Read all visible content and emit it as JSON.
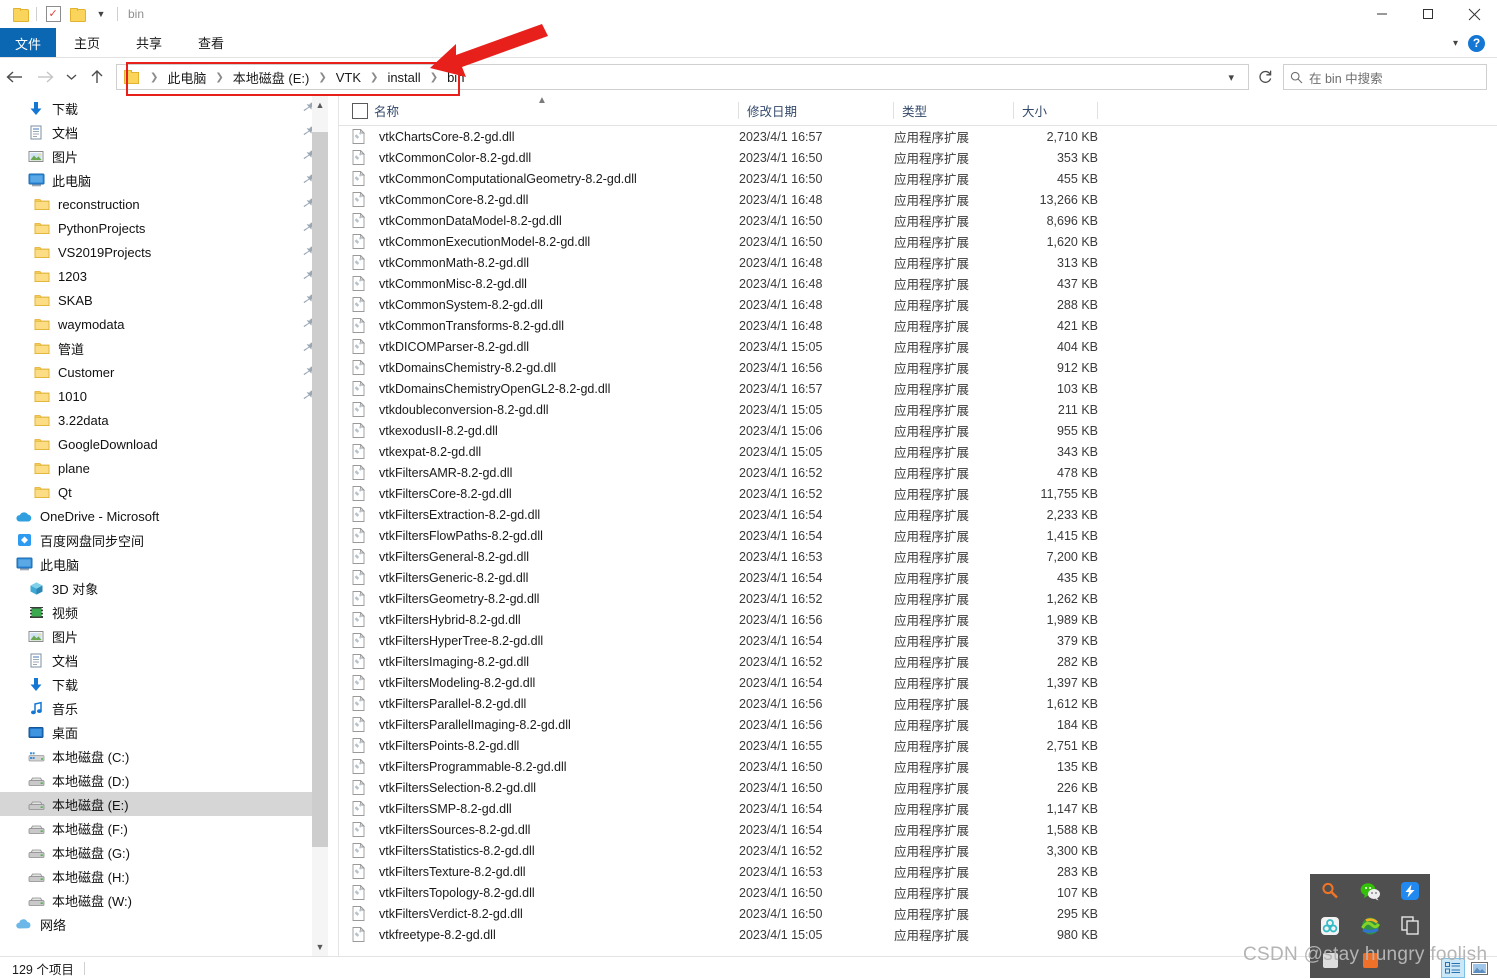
{
  "window": {
    "title": "bin",
    "quick_access": [
      "folder-icon",
      "properties-icon",
      "new-folder-icon",
      "customize-chevron-icon"
    ],
    "controls": {
      "minimize": "minimize-icon",
      "maximize": "maximize-icon",
      "close": "close-icon"
    }
  },
  "ribbon": {
    "tabs": [
      {
        "label": "文件",
        "active": true
      },
      {
        "label": "主页",
        "active": false
      },
      {
        "label": "共享",
        "active": false
      },
      {
        "label": "查看",
        "active": false
      }
    ],
    "collapse_label": "⌄",
    "help_label": "?"
  },
  "nav_toolbar": {
    "back": "back-arrow-icon",
    "forward": "forward-arrow-icon",
    "recent": "chevron-down-icon",
    "up": "up-arrow-icon",
    "refresh": "refresh-icon"
  },
  "breadcrumb": {
    "icon": "folder-icon",
    "items": [
      "此电脑",
      "本地磁盘 (E:)",
      "VTK",
      "install",
      "bin"
    ],
    "separator": "›",
    "dropdown": "chevron-down-icon",
    "highlighted": true
  },
  "search": {
    "icon": "search-icon",
    "placeholder": "在 bin 中搜索",
    "value": ""
  },
  "sidebar": {
    "items": [
      {
        "label": "下载",
        "icon": "download-icon",
        "indent": 1,
        "pinned": true,
        "selected": false
      },
      {
        "label": "文档",
        "icon": "documents-icon",
        "indent": 1,
        "pinned": true,
        "selected": false
      },
      {
        "label": "图片",
        "icon": "pictures-icon",
        "indent": 1,
        "pinned": true,
        "selected": false
      },
      {
        "label": "此电脑",
        "icon": "this-pc-icon",
        "indent": 1,
        "pinned": true,
        "selected": false
      },
      {
        "label": "reconstruction",
        "icon": "folder-icon",
        "indent": 2,
        "pinned": true,
        "selected": false
      },
      {
        "label": "PythonProjects",
        "icon": "folder-icon",
        "indent": 2,
        "pinned": true,
        "selected": false
      },
      {
        "label": "VS2019Projects",
        "icon": "folder-icon",
        "indent": 2,
        "pinned": true,
        "selected": false
      },
      {
        "label": "1203",
        "icon": "folder-icon",
        "indent": 2,
        "pinned": true,
        "selected": false
      },
      {
        "label": "SKAB",
        "icon": "folder-icon",
        "indent": 2,
        "pinned": true,
        "selected": false
      },
      {
        "label": "waymodata",
        "icon": "folder-icon",
        "indent": 2,
        "pinned": true,
        "selected": false
      },
      {
        "label": "管道",
        "icon": "folder-icon",
        "indent": 2,
        "pinned": true,
        "selected": false
      },
      {
        "label": "Customer",
        "icon": "folder-icon",
        "indent": 2,
        "pinned": true,
        "selected": false
      },
      {
        "label": "1010",
        "icon": "folder-icon",
        "indent": 2,
        "pinned": true,
        "selected": false
      },
      {
        "label": "3.22data",
        "icon": "folder-icon",
        "indent": 2,
        "pinned": false,
        "selected": false
      },
      {
        "label": "GoogleDownload",
        "icon": "folder-icon",
        "indent": 2,
        "pinned": false,
        "selected": false
      },
      {
        "label": "plane",
        "icon": "folder-icon",
        "indent": 2,
        "pinned": false,
        "selected": false
      },
      {
        "label": "Qt",
        "icon": "folder-icon",
        "indent": 2,
        "pinned": false,
        "selected": false
      },
      {
        "label": "OneDrive - Microsoft",
        "icon": "onedrive-icon",
        "indent": 0,
        "pinned": false,
        "selected": false
      },
      {
        "label": "百度网盘同步空间",
        "icon": "baidu-netdisk-icon",
        "indent": 0,
        "pinned": false,
        "selected": false
      },
      {
        "label": "此电脑",
        "icon": "this-pc-icon",
        "indent": 0,
        "pinned": false,
        "selected": false
      },
      {
        "label": "3D 对象",
        "icon": "3d-objects-icon",
        "indent": 1,
        "pinned": false,
        "selected": false
      },
      {
        "label": "视频",
        "icon": "videos-icon",
        "indent": 1,
        "pinned": false,
        "selected": false
      },
      {
        "label": "图片",
        "icon": "pictures-icon",
        "indent": 1,
        "pinned": false,
        "selected": false
      },
      {
        "label": "文档",
        "icon": "documents-icon",
        "indent": 1,
        "pinned": false,
        "selected": false
      },
      {
        "label": "下载",
        "icon": "download-icon",
        "indent": 1,
        "pinned": false,
        "selected": false
      },
      {
        "label": "音乐",
        "icon": "music-icon",
        "indent": 1,
        "pinned": false,
        "selected": false
      },
      {
        "label": "桌面",
        "icon": "desktop-icon",
        "indent": 1,
        "pinned": false,
        "selected": false
      },
      {
        "label": "本地磁盘 (C:)",
        "icon": "system-drive-icon",
        "indent": 1,
        "pinned": false,
        "selected": false
      },
      {
        "label": "本地磁盘 (D:)",
        "icon": "drive-icon",
        "indent": 1,
        "pinned": false,
        "selected": false
      },
      {
        "label": "本地磁盘 (E:)",
        "icon": "drive-icon",
        "indent": 1,
        "pinned": false,
        "selected": true
      },
      {
        "label": "本地磁盘 (F:)",
        "icon": "drive-icon",
        "indent": 1,
        "pinned": false,
        "selected": false
      },
      {
        "label": "本地磁盘 (G:)",
        "icon": "drive-icon",
        "indent": 1,
        "pinned": false,
        "selected": false
      },
      {
        "label": "本地磁盘 (H:)",
        "icon": "drive-icon",
        "indent": 1,
        "pinned": false,
        "selected": false
      },
      {
        "label": "本地磁盘 (W:)",
        "icon": "drive-icon",
        "indent": 1,
        "pinned": false,
        "selected": false
      },
      {
        "label": "网络",
        "icon": "network-icon",
        "indent": 0,
        "pinned": false,
        "selected": false
      }
    ]
  },
  "file_list": {
    "columns": [
      {
        "key": "name",
        "label": "名称",
        "sorted": "asc"
      },
      {
        "key": "date",
        "label": "修改日期",
        "sorted": ""
      },
      {
        "key": "type",
        "label": "类型",
        "sorted": ""
      },
      {
        "key": "size",
        "label": "大小",
        "sorted": ""
      }
    ],
    "rows": [
      {
        "name": "vtkChartsCore-8.2-gd.dll",
        "date": "2023/4/1 16:57",
        "type": "应用程序扩展",
        "size": "2,710 KB"
      },
      {
        "name": "vtkCommonColor-8.2-gd.dll",
        "date": "2023/4/1 16:50",
        "type": "应用程序扩展",
        "size": "353 KB"
      },
      {
        "name": "vtkCommonComputationalGeometry-8.2-gd.dll",
        "date": "2023/4/1 16:50",
        "type": "应用程序扩展",
        "size": "455 KB"
      },
      {
        "name": "vtkCommonCore-8.2-gd.dll",
        "date": "2023/4/1 16:48",
        "type": "应用程序扩展",
        "size": "13,266 KB"
      },
      {
        "name": "vtkCommonDataModel-8.2-gd.dll",
        "date": "2023/4/1 16:50",
        "type": "应用程序扩展",
        "size": "8,696 KB"
      },
      {
        "name": "vtkCommonExecutionModel-8.2-gd.dll",
        "date": "2023/4/1 16:50",
        "type": "应用程序扩展",
        "size": "1,620 KB"
      },
      {
        "name": "vtkCommonMath-8.2-gd.dll",
        "date": "2023/4/1 16:48",
        "type": "应用程序扩展",
        "size": "313 KB"
      },
      {
        "name": "vtkCommonMisc-8.2-gd.dll",
        "date": "2023/4/1 16:48",
        "type": "应用程序扩展",
        "size": "437 KB"
      },
      {
        "name": "vtkCommonSystem-8.2-gd.dll",
        "date": "2023/4/1 16:48",
        "type": "应用程序扩展",
        "size": "288 KB"
      },
      {
        "name": "vtkCommonTransforms-8.2-gd.dll",
        "date": "2023/4/1 16:48",
        "type": "应用程序扩展",
        "size": "421 KB"
      },
      {
        "name": "vtkDICOMParser-8.2-gd.dll",
        "date": "2023/4/1 15:05",
        "type": "应用程序扩展",
        "size": "404 KB"
      },
      {
        "name": "vtkDomainsChemistry-8.2-gd.dll",
        "date": "2023/4/1 16:56",
        "type": "应用程序扩展",
        "size": "912 KB"
      },
      {
        "name": "vtkDomainsChemistryOpenGL2-8.2-gd.dll",
        "date": "2023/4/1 16:57",
        "type": "应用程序扩展",
        "size": "103 KB"
      },
      {
        "name": "vtkdoubleconversion-8.2-gd.dll",
        "date": "2023/4/1 15:05",
        "type": "应用程序扩展",
        "size": "211 KB"
      },
      {
        "name": "vtkexodusII-8.2-gd.dll",
        "date": "2023/4/1 15:06",
        "type": "应用程序扩展",
        "size": "955 KB"
      },
      {
        "name": "vtkexpat-8.2-gd.dll",
        "date": "2023/4/1 15:05",
        "type": "应用程序扩展",
        "size": "343 KB"
      },
      {
        "name": "vtkFiltersAMR-8.2-gd.dll",
        "date": "2023/4/1 16:52",
        "type": "应用程序扩展",
        "size": "478 KB"
      },
      {
        "name": "vtkFiltersCore-8.2-gd.dll",
        "date": "2023/4/1 16:52",
        "type": "应用程序扩展",
        "size": "11,755 KB"
      },
      {
        "name": "vtkFiltersExtraction-8.2-gd.dll",
        "date": "2023/4/1 16:54",
        "type": "应用程序扩展",
        "size": "2,233 KB"
      },
      {
        "name": "vtkFiltersFlowPaths-8.2-gd.dll",
        "date": "2023/4/1 16:54",
        "type": "应用程序扩展",
        "size": "1,415 KB"
      },
      {
        "name": "vtkFiltersGeneral-8.2-gd.dll",
        "date": "2023/4/1 16:53",
        "type": "应用程序扩展",
        "size": "7,200 KB"
      },
      {
        "name": "vtkFiltersGeneric-8.2-gd.dll",
        "date": "2023/4/1 16:54",
        "type": "应用程序扩展",
        "size": "435 KB"
      },
      {
        "name": "vtkFiltersGeometry-8.2-gd.dll",
        "date": "2023/4/1 16:52",
        "type": "应用程序扩展",
        "size": "1,262 KB"
      },
      {
        "name": "vtkFiltersHybrid-8.2-gd.dll",
        "date": "2023/4/1 16:56",
        "type": "应用程序扩展",
        "size": "1,989 KB"
      },
      {
        "name": "vtkFiltersHyperTree-8.2-gd.dll",
        "date": "2023/4/1 16:54",
        "type": "应用程序扩展",
        "size": "379 KB"
      },
      {
        "name": "vtkFiltersImaging-8.2-gd.dll",
        "date": "2023/4/1 16:52",
        "type": "应用程序扩展",
        "size": "282 KB"
      },
      {
        "name": "vtkFiltersModeling-8.2-gd.dll",
        "date": "2023/4/1 16:54",
        "type": "应用程序扩展",
        "size": "1,397 KB"
      },
      {
        "name": "vtkFiltersParallel-8.2-gd.dll",
        "date": "2023/4/1 16:56",
        "type": "应用程序扩展",
        "size": "1,612 KB"
      },
      {
        "name": "vtkFiltersParallelImaging-8.2-gd.dll",
        "date": "2023/4/1 16:56",
        "type": "应用程序扩展",
        "size": "184 KB"
      },
      {
        "name": "vtkFiltersPoints-8.2-gd.dll",
        "date": "2023/4/1 16:55",
        "type": "应用程序扩展",
        "size": "2,751 KB"
      },
      {
        "name": "vtkFiltersProgrammable-8.2-gd.dll",
        "date": "2023/4/1 16:50",
        "type": "应用程序扩展",
        "size": "135 KB"
      },
      {
        "name": "vtkFiltersSelection-8.2-gd.dll",
        "date": "2023/4/1 16:50",
        "type": "应用程序扩展",
        "size": "226 KB"
      },
      {
        "name": "vtkFiltersSMP-8.2-gd.dll",
        "date": "2023/4/1 16:54",
        "type": "应用程序扩展",
        "size": "1,147 KB"
      },
      {
        "name": "vtkFiltersSources-8.2-gd.dll",
        "date": "2023/4/1 16:54",
        "type": "应用程序扩展",
        "size": "1,588 KB"
      },
      {
        "name": "vtkFiltersStatistics-8.2-gd.dll",
        "date": "2023/4/1 16:52",
        "type": "应用程序扩展",
        "size": "3,300 KB"
      },
      {
        "name": "vtkFiltersTexture-8.2-gd.dll",
        "date": "2023/4/1 16:53",
        "type": "应用程序扩展",
        "size": "283 KB"
      },
      {
        "name": "vtkFiltersTopology-8.2-gd.dll",
        "date": "2023/4/1 16:50",
        "type": "应用程序扩展",
        "size": "107 KB"
      },
      {
        "name": "vtkFiltersVerdict-8.2-gd.dll",
        "date": "2023/4/1 16:50",
        "type": "应用程序扩展",
        "size": "295 KB"
      },
      {
        "name": "vtkfreetype-8.2-gd.dll",
        "date": "2023/4/1 15:05",
        "type": "应用程序扩展",
        "size": "980 KB"
      }
    ]
  },
  "status_bar": {
    "item_count": "129 个项目",
    "views": [
      {
        "name": "details-view",
        "active": true
      },
      {
        "name": "large-icons-view",
        "active": false
      }
    ]
  },
  "overlay_dock": {
    "icons": [
      "magnifier-icon",
      "wechat-icon",
      "thunder-icon",
      "360-browser-icon",
      "idm-icon",
      "copy-icon",
      "app-icon-7",
      "app-icon-8",
      "app-icon-9"
    ]
  },
  "watermark": {
    "text": "CSDN @stay hungry foolish"
  },
  "colors": {
    "accent": "#0b67b2",
    "annotation": "#e8201b",
    "selection": "#d6d6d6",
    "header_text": "#33496b",
    "folder": "#fbd45c"
  }
}
